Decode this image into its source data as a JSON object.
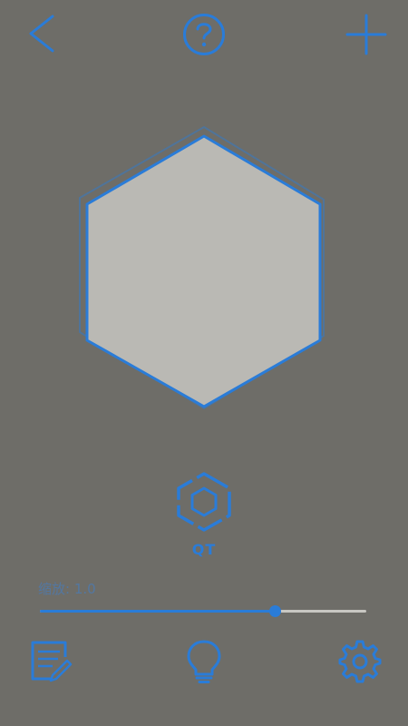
{
  "colors": {
    "accent": "#2a7cd8",
    "background": "#6e6d68",
    "hex_fill": "#bab9b4",
    "track_inactive": "#c8c7c2"
  },
  "header": {
    "back_icon": "chevron-left-icon",
    "help_icon": "question-circle-icon",
    "add_icon": "plus-icon"
  },
  "shape": {
    "type": "hexagon",
    "mode_icon": "hex-nut-icon",
    "mode_label": "QT"
  },
  "size_control": {
    "label": "缩放: 1.0",
    "value_fraction": 0.72
  },
  "footer": {
    "notes_icon": "edit-note-icon",
    "hint_icon": "lightbulb-icon",
    "settings_icon": "gear-icon"
  }
}
